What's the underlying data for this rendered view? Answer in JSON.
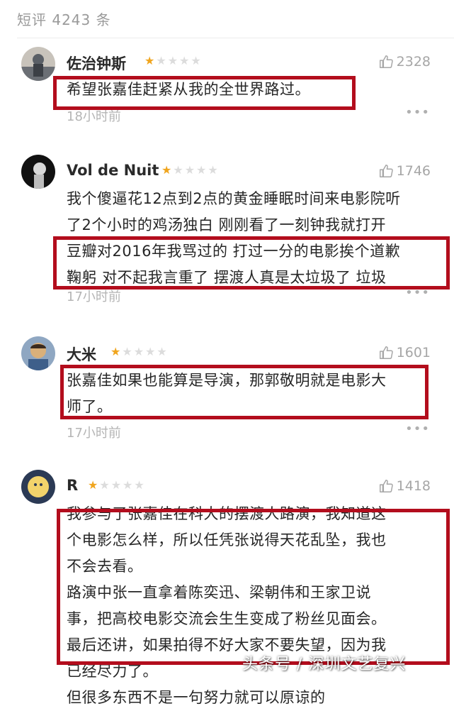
{
  "header": {
    "title": "短评 4243 条"
  },
  "comments": [
    {
      "user": "佐治钟斯",
      "rating": 1,
      "votes": "2328",
      "lines": [
        "希望张嘉佳赶紧从我的全世界路过。"
      ],
      "time": "18小时前",
      "avatar_colors": [
        "#5a5f66",
        "#c8c3bb"
      ]
    },
    {
      "user": "Vol de Nuit",
      "rating": 1,
      "votes": "1746",
      "lines": [
        "我个傻逼花12点到2点的黄金睡眠时间来电影院听",
        "了2个小时的鸡汤独白 刚刚看了一刻钟我就打开",
        "豆瓣对2016年我骂过的 打过一分的电影挨个道歉",
        "鞠躬 对不起我言重了 摆渡人真是太垃圾了 垃圾"
      ],
      "time": "17小时前",
      "avatar_colors": [
        "#111111",
        "#d8d8d8"
      ]
    },
    {
      "user": "大米",
      "rating": 1,
      "votes": "1601",
      "lines": [
        "张嘉佳如果也能算是导演，那郭敬明就是电影大",
        "师了。"
      ],
      "time": "17小时前",
      "avatar_colors": [
        "#3e5f8a",
        "#d9b07a"
      ]
    },
    {
      "user": "R",
      "rating": 1,
      "votes": "1418",
      "lines": [
        "我参与了张嘉佳在科大的摆渡人路演，我知道这",
        "个电影怎么样，所以任凭张说得天花乱坠，我也",
        "不会去看。",
        "路演中张一直拿着陈奕迅、梁朝伟和王家卫说",
        "事，把高校电影交流会生生变成了粉丝见面会。",
        "最后还讲，如果拍得不好大家不要失望，因为我",
        "已经尽力了。",
        "但很多东西不是一句努力就可以原谅的"
      ],
      "time": "",
      "avatar_colors": [
        "#2b3a55",
        "#f2d36b"
      ]
    }
  ],
  "more_label": "•••",
  "watermark": "头条号 / 深圳文艺复兴",
  "colors": {
    "highlight": "#b30d1d",
    "star": "#f0a51e"
  }
}
